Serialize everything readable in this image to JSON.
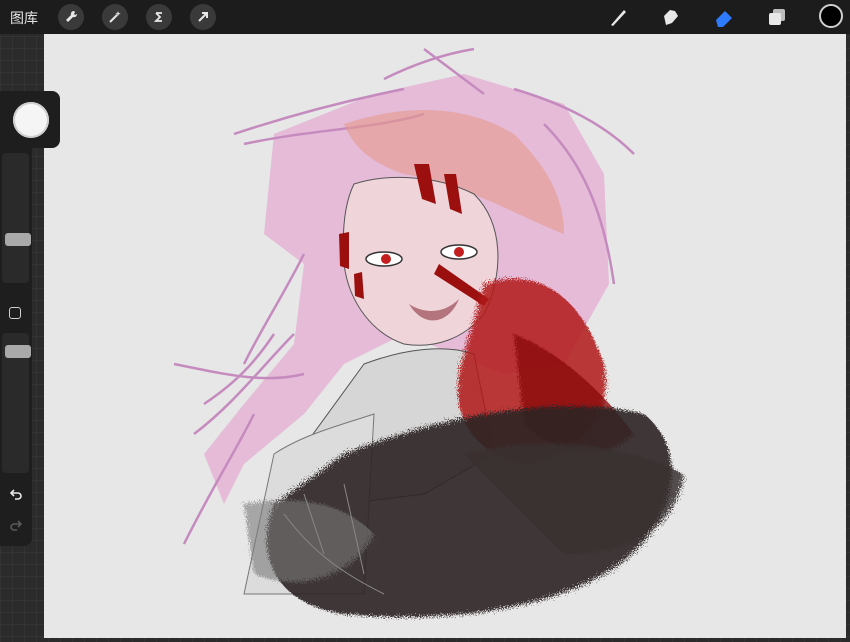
{
  "topbar": {
    "gallery_label": "图库",
    "left_tools": [
      "wrench-icon",
      "magic-wand-icon",
      "selection-icon",
      "transform-arrow-icon"
    ],
    "right_tools": [
      "brush-icon",
      "smudge-icon",
      "eraser-icon",
      "layers-icon"
    ],
    "active_tool": "eraser-icon",
    "accent_color": "#2f7bff",
    "current_color": "#000000"
  },
  "sidebar": {
    "brush_size_level": 0.55,
    "opacity_level": 0.62
  },
  "canvas": {
    "background": "#e7e7e7",
    "artwork": "illustration-pink-haired-figure-with-red-and-black-splatter"
  }
}
